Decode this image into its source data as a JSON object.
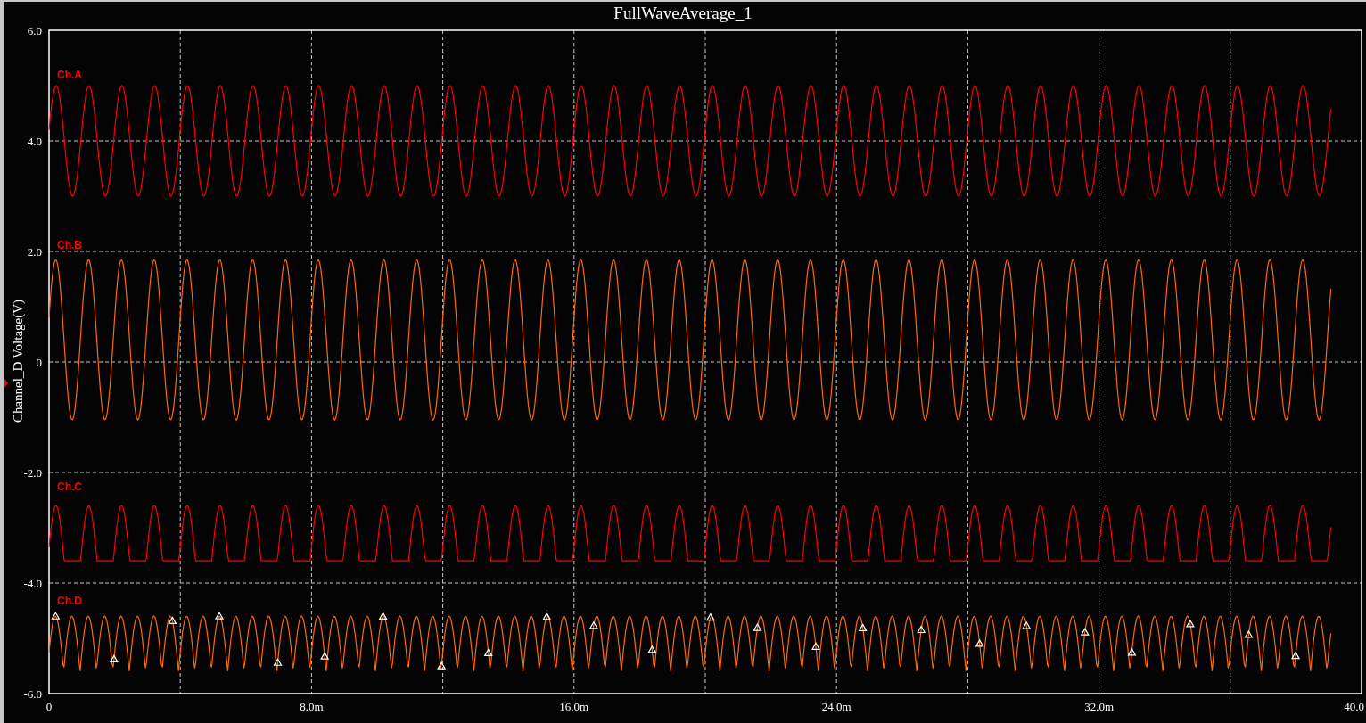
{
  "plot": {
    "title": "FullWaveAverage_1",
    "y_axis_label": "Channel_D Voltage(V)",
    "y_ticks": [
      "6.0",
      "4.0",
      "2.0",
      "0",
      "-2.0",
      "-4.0",
      "-6.0"
    ],
    "x_ticks": [
      "0",
      "8.0m",
      "16.0m",
      "24.0m",
      "32.0m",
      "40.0"
    ],
    "channels": [
      {
        "label": "Ch.A",
        "kind": "sine",
        "color": "#ff0000"
      },
      {
        "label": "Ch.B",
        "kind": "sine",
        "color": "#ff6a00"
      },
      {
        "label": "Ch.C",
        "kind": "halfwave",
        "color": "#ff0000"
      },
      {
        "label": "Ch.D",
        "kind": "fullwave",
        "color": "#ff6a00"
      }
    ]
  }
}
